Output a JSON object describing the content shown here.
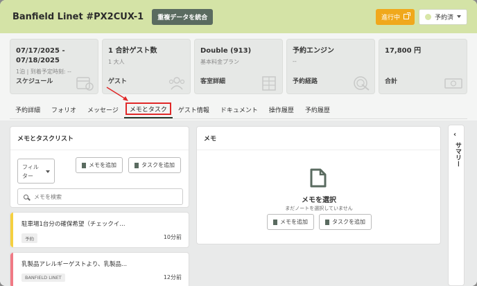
{
  "header": {
    "title": "Banfield Linet #PX2CUX-1",
    "merge_label": "重複データを統合",
    "status_label": "進行中",
    "state_label": "予約済"
  },
  "cards": [
    {
      "main": "07/17/2025 -\n07/18/2025",
      "sub": "1泊 | 到着予定時刻: --",
      "label": "スケジュール",
      "icon": "calendar-icon"
    },
    {
      "main": "1 合計ゲスト数",
      "sub": "1 大人",
      "label": "ゲスト",
      "icon": "guests-icon"
    },
    {
      "main": "Double (913)",
      "sub": "基本料金プラン",
      "label": "客室詳細",
      "icon": "room-icon"
    },
    {
      "main": "予約エンジン",
      "sub": "--",
      "label": "予約経路",
      "icon": "cursor-icon"
    },
    {
      "main": "17,800 円",
      "sub": "",
      "label": "合計",
      "icon": "money-icon"
    }
  ],
  "tabs": [
    "予約詳細",
    "フォリオ",
    "メッセージ",
    "メモとタスク",
    "ゲスト情報",
    "ドキュメント",
    "操作履歴",
    "予約履歴"
  ],
  "active_tab": "メモとタスク",
  "left_panel": {
    "title": "メモとタスクリスト",
    "filter_label": "フィル\nター",
    "add_note_label": "メモを追加",
    "add_task_label": "タスクを追加",
    "search_placeholder": "メモを検索"
  },
  "notes": [
    {
      "title": "駐車場1台分の確保希望（チェックイ...",
      "tag": "予約",
      "time": "10分前",
      "color": "#f5d040"
    },
    {
      "title": "乳製品アレルギーゲストより、乳製品...",
      "tag": "BANFIELD LINET",
      "time": "12分前",
      "color": "#f07a85"
    }
  ],
  "right_panel": {
    "title": "メモ",
    "empty_title": "メモを選択",
    "empty_sub": "まだノートを選択していません",
    "add_note_label": "メモを追加",
    "add_task_label": "タスクを追加"
  },
  "side_panel": {
    "label": "サマリー"
  },
  "colors": {
    "header": "#d4e3a6",
    "status": "#f0a81c",
    "merge": "#5a6b60",
    "highlight": "#e02828"
  }
}
